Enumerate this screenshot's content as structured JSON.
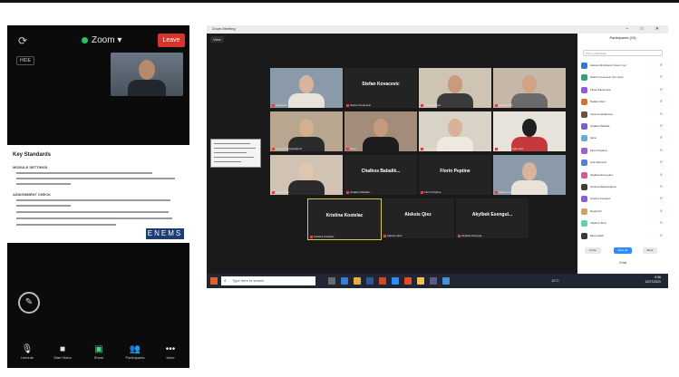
{
  "phone": {
    "app_label": "Zoom",
    "leave_label": "Leave",
    "hide_label": "HIDE",
    "doc_title": "Key Standards",
    "doc_section1": "MODULE SETTINGS",
    "doc_section2": "ASSIGNMENT CHECK",
    "logo_text": "ENEMS",
    "toolbar": [
      {
        "label": "Unmute",
        "icon": "microphone-icon"
      },
      {
        "label": "Start Video",
        "icon": "video-icon"
      },
      {
        "label": "Share",
        "icon": "share-icon"
      },
      {
        "label": "Participants",
        "icon": "participants-icon"
      },
      {
        "label": "More",
        "icon": "more-icon"
      }
    ]
  },
  "desktop": {
    "window_title": "Zoom Meeting",
    "view_label": "View",
    "tiles": [
      {
        "name": "",
        "label": "Dagoll Ali",
        "video": true
      },
      {
        "name": "Stefan Kovacevic",
        "label": "Stefan Kovacevic",
        "video": false
      },
      {
        "name": "",
        "label": "Ana Markovic",
        "video": true
      },
      {
        "name": "",
        "label": "Ivan Nikolic",
        "video": true
      },
      {
        "name": "",
        "label": "Jovana Radosavljevic",
        "video": true
      },
      {
        "name": "",
        "label": "Iskra",
        "video": true
      },
      {
        "name": "",
        "label": "Ivana Kostadinova",
        "video": true
      },
      {
        "name": "",
        "label": "Natalia Georgievska",
        "video": true
      },
      {
        "name": "",
        "label": "Elena Aleki",
        "video": true
      },
      {
        "name": "Chalkos Babalik...",
        "label": "Chalkos Babalik...",
        "video": false
      },
      {
        "name": "Florin Peptine",
        "label": "Florin Peptine",
        "video": false
      },
      {
        "name": "",
        "label": "Vladimir Zivic",
        "video": true
      },
      {
        "name": "Kristina Kostelac",
        "label": "Kristina Kostelac",
        "video": false,
        "active": true
      },
      {
        "name": "Aleksis Qiez",
        "label": "Aleksis Qiez",
        "video": false
      },
      {
        "name": "Akylbek Esengul...",
        "label": "Akylbek Esengul...",
        "video": false
      }
    ],
    "participants_title": "Participants (19)",
    "search_placeholder": "Find a participant",
    "participants": [
      {
        "name": "Aleksis Dimitrijevic (Host, me)",
        "color": "#2b7bd6"
      },
      {
        "name": "Stefan Kovacevic (Co-host)",
        "color": "#2fa16b"
      },
      {
        "name": "Filipa Nikolovska",
        "color": "#8f5bd6"
      },
      {
        "name": "Natalia Aleki",
        "color": "#d6702b"
      },
      {
        "name": "Ivana Kostadinova",
        "color": "#6b4f3a"
      },
      {
        "name": "Chalkos Babalik",
        "color": "#7c5bd6"
      },
      {
        "name": "Iskra",
        "color": "#5bb1d6"
      },
      {
        "name": "Florin Peptine",
        "color": "#a35bd6"
      },
      {
        "name": "Ana Markovic",
        "color": "#5b7cd6"
      },
      {
        "name": "Akylbek Esengulov",
        "color": "#d65b9a"
      },
      {
        "name": "Jovana Radosavljevic",
        "color": "#4a3a30"
      },
      {
        "name": "Kristina Kostelac",
        "color": "#8d5bd6"
      },
      {
        "name": "Dagoll Ali",
        "color": "#d6a15b"
      },
      {
        "name": "Vladimir Zivic",
        "color": "#5bd6a1"
      },
      {
        "name": "Elena Aleki",
        "color": "#3a3a3a"
      }
    ],
    "invite_label": "Invite",
    "mute_all_label": "Mute All",
    "more_label": "More",
    "chat_label": "Chat",
    "taskbar_search": "Type here to search",
    "clock_time": "9:36",
    "clock_date": "10/27/2021",
    "tray_text": "16°C"
  }
}
